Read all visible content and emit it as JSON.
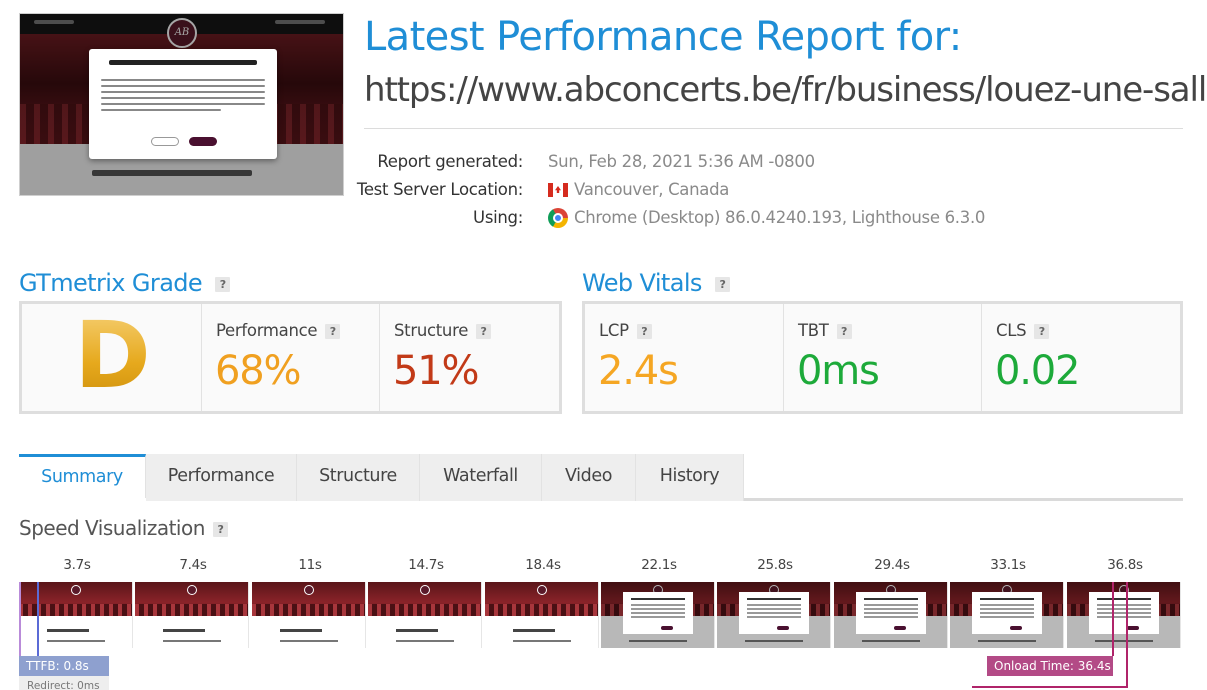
{
  "screenshot": {
    "page_heading": "Louez une salle",
    "page_text": "Ajoutez une touche rock'n'roll à vos",
    "cookie_title": "Polly wants a cracker, voulez-vous des cookies ?",
    "logo_text": "AB"
  },
  "header": {
    "title": "Latest Performance Report for:",
    "url": "https://www.abconcerts.be/fr/business/louez-une-salle"
  },
  "meta": {
    "generated_label": "Report generated:",
    "generated_value": "Sun, Feb 28, 2021 5:36 AM -0800",
    "location_label": "Test Server Location:",
    "location_value": "Vancouver, Canada",
    "location_icon": "canada-flag-icon",
    "using_label": "Using:",
    "using_value": "Chrome (Desktop) 86.0.4240.193, Lighthouse 6.3.0",
    "using_icon": "chrome-icon"
  },
  "grade": {
    "title": "GTmetrix Grade",
    "help": "?",
    "letter": "D",
    "performance_label": "Performance",
    "performance_value": "68%",
    "structure_label": "Structure",
    "structure_value": "51%"
  },
  "vitals": {
    "title": "Web Vitals",
    "help": "?",
    "lcp_label": "LCP",
    "lcp_value": "2.4s",
    "tbt_label": "TBT",
    "tbt_value": "0ms",
    "cls_label": "CLS",
    "cls_value": "0.02"
  },
  "colors": {
    "accent": "#1f8ed6",
    "grade_d": "#e6a91d",
    "performance": "#f0a020",
    "structure": "#c23a18",
    "lcp": "#f5a623",
    "good": "#1daa3a",
    "onload": "#b0246a"
  },
  "tabs": [
    "Summary",
    "Performance",
    "Structure",
    "Waterfall",
    "Video",
    "History"
  ],
  "speed": {
    "title": "Speed Visualization",
    "help": "?",
    "ticks": [
      "3.7s",
      "7.4s",
      "11s",
      "14.7s",
      "18.4s",
      "22.1s",
      "25.8s",
      "29.4s",
      "33.1s",
      "36.8s"
    ],
    "ttfb": "TTFB: 0.8s",
    "redirect": "Redirect: 0ms",
    "onload": "Onload Time: 36.4s"
  }
}
